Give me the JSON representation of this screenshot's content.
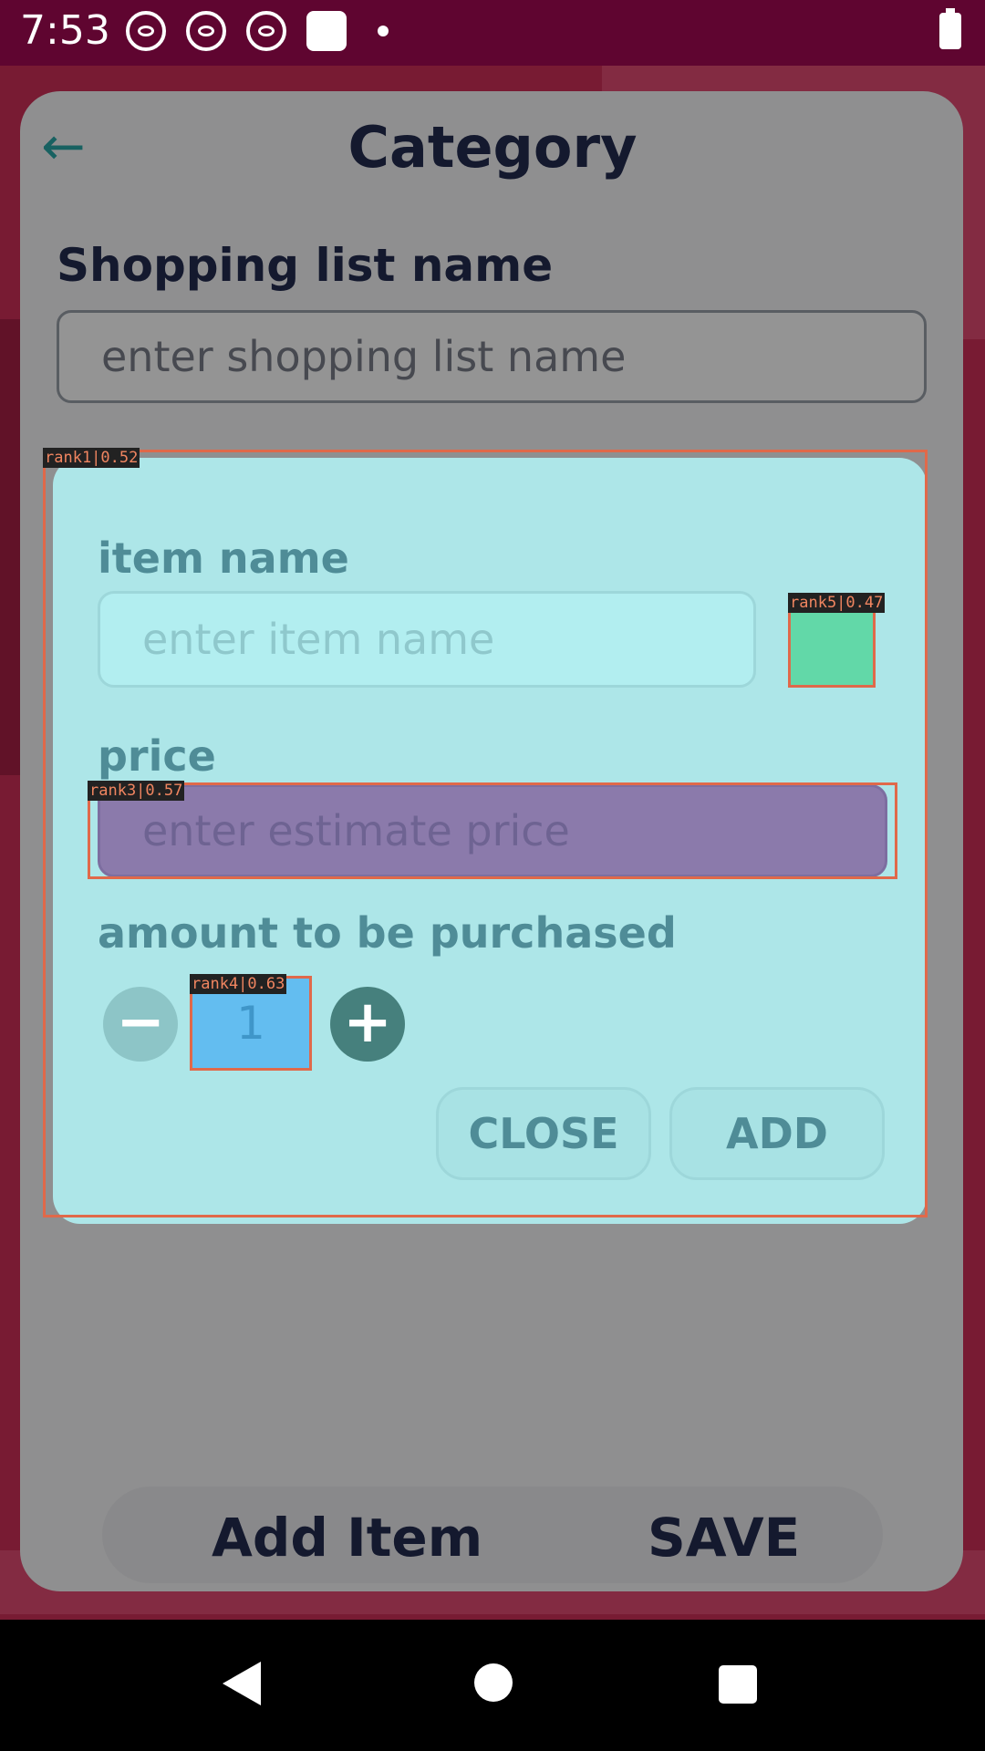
{
  "status_bar": {
    "time": "7:53",
    "icons": [
      "notification-icon",
      "notification-icon",
      "notification-icon",
      "square-icon",
      "dot-icon",
      "battery-charging-icon"
    ]
  },
  "screen": {
    "title": "Category",
    "shopping_list_label": "Shopping list name",
    "shopping_list_placeholder": "enter shopping list name",
    "add_item_label": "Add Item",
    "save_label": "SAVE"
  },
  "dialog": {
    "item_name_label": "item name",
    "item_name_placeholder": "enter item name",
    "price_label": "price",
    "price_placeholder": "enter estimate price",
    "amount_label": "amount to be purchased",
    "quantity": "1",
    "minus_symbol": "−",
    "plus_symbol": "+",
    "close_label": "CLOSE",
    "add_label": "ADD"
  },
  "annotations": {
    "rank1": "rank1|0.52",
    "rank3": "rank3|0.57",
    "rank4": "rank4|0.63",
    "rank5": "rank5|0.47"
  },
  "colors": {
    "status_bar": "#5f0530",
    "dialog_background": "#ade6e8",
    "title_text": "#232b50",
    "accent_teal": "#2aa7a7",
    "annotation_border": "#e0694a"
  }
}
